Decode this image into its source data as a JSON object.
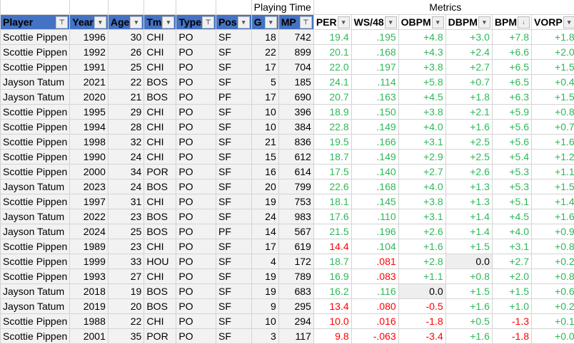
{
  "groups": {
    "playing_time": "Playing Time",
    "metrics": "Metrics"
  },
  "columns": [
    "Player",
    "Year",
    "Age",
    "Tm",
    "Type",
    "Pos",
    "G",
    "MP",
    "PER",
    "WS/48",
    "OBPM",
    "DBPM",
    "BPM",
    "VORP"
  ],
  "filter_icons": [
    "filter-active",
    "dropdown",
    "dropdown",
    "dropdown",
    "filter-active",
    "dropdown",
    "dropdown",
    "filter-active",
    "dropdown",
    "dropdown",
    "dropdown",
    "dropdown",
    "sort-desc",
    "dropdown"
  ],
  "colors": {
    "header": "#4472c4",
    "good": "#2fb85a",
    "bad": "#ff0000"
  },
  "rows": [
    [
      "Scottie Pippen",
      "1996",
      "30",
      "CHI",
      "PO",
      "SF",
      "18",
      "742",
      "19.4",
      ".195",
      "+4.8",
      "+3.0",
      "+7.8",
      "+1.8"
    ],
    [
      "Scottie Pippen",
      "1992",
      "26",
      "CHI",
      "PO",
      "SF",
      "22",
      "899",
      "20.1",
      ".168",
      "+4.3",
      "+2.4",
      "+6.6",
      "+2.0"
    ],
    [
      "Scottie Pippen",
      "1991",
      "25",
      "CHI",
      "PO",
      "SF",
      "17",
      "704",
      "22.0",
      ".197",
      "+3.8",
      "+2.7",
      "+6.5",
      "+1.5"
    ],
    [
      "Jayson Tatum",
      "2021",
      "22",
      "BOS",
      "PO",
      "SF",
      "5",
      "185",
      "24.1",
      ".114",
      "+5.8",
      "+0.7",
      "+6.5",
      "+0.4"
    ],
    [
      "Jayson Tatum",
      "2020",
      "21",
      "BOS",
      "PO",
      "PF",
      "17",
      "690",
      "20.7",
      ".163",
      "+4.5",
      "+1.8",
      "+6.3",
      "+1.5"
    ],
    [
      "Scottie Pippen",
      "1995",
      "29",
      "CHI",
      "PO",
      "SF",
      "10",
      "396",
      "18.9",
      ".150",
      "+3.8",
      "+2.1",
      "+5.9",
      "+0.8"
    ],
    [
      "Scottie Pippen",
      "1994",
      "28",
      "CHI",
      "PO",
      "SF",
      "10",
      "384",
      "22.8",
      ".149",
      "+4.0",
      "+1.6",
      "+5.6",
      "+0.7"
    ],
    [
      "Scottie Pippen",
      "1998",
      "32",
      "CHI",
      "PO",
      "SF",
      "21",
      "836",
      "19.5",
      ".166",
      "+3.1",
      "+2.5",
      "+5.6",
      "+1.6"
    ],
    [
      "Scottie Pippen",
      "1990",
      "24",
      "CHI",
      "PO",
      "SF",
      "15",
      "612",
      "18.7",
      ".149",
      "+2.9",
      "+2.5",
      "+5.4",
      "+1.2"
    ],
    [
      "Scottie Pippen",
      "2000",
      "34",
      "POR",
      "PO",
      "SF",
      "16",
      "614",
      "17.5",
      ".140",
      "+2.7",
      "+2.6",
      "+5.3",
      "+1.1"
    ],
    [
      "Jayson Tatum",
      "2023",
      "24",
      "BOS",
      "PO",
      "SF",
      "20",
      "799",
      "22.6",
      ".168",
      "+4.0",
      "+1.3",
      "+5.3",
      "+1.5"
    ],
    [
      "Scottie Pippen",
      "1997",
      "31",
      "CHI",
      "PO",
      "SF",
      "19",
      "753",
      "18.1",
      ".145",
      "+3.8",
      "+1.3",
      "+5.1",
      "+1.4"
    ],
    [
      "Jayson Tatum",
      "2022",
      "23",
      "BOS",
      "PO",
      "SF",
      "24",
      "983",
      "17.6",
      ".110",
      "+3.1",
      "+1.4",
      "+4.5",
      "+1.6"
    ],
    [
      "Jayson Tatum",
      "2024",
      "25",
      "BOS",
      "PO",
      "PF",
      "14",
      "567",
      "21.5",
      ".196",
      "+2.6",
      "+1.4",
      "+4.0",
      "+0.9"
    ],
    [
      "Scottie Pippen",
      "1989",
      "23",
      "CHI",
      "PO",
      "SF",
      "17",
      "619",
      "14.4",
      ".104",
      "+1.6",
      "+1.5",
      "+3.1",
      "+0.8"
    ],
    [
      "Scottie Pippen",
      "1999",
      "33",
      "HOU",
      "PO",
      "SF",
      "4",
      "172",
      "18.7",
      ".081",
      "+2.8",
      "0.0",
      "+2.7",
      "+0.2"
    ],
    [
      "Scottie Pippen",
      "1993",
      "27",
      "CHI",
      "PO",
      "SF",
      "19",
      "789",
      "16.9",
      ".083",
      "+1.1",
      "+0.8",
      "+2.0",
      "+0.8"
    ],
    [
      "Jayson Tatum",
      "2018",
      "19",
      "BOS",
      "PO",
      "SF",
      "19",
      "683",
      "16.2",
      ".116",
      "0.0",
      "+1.5",
      "+1.5",
      "+0.6"
    ],
    [
      "Jayson Tatum",
      "2019",
      "20",
      "BOS",
      "PO",
      "SF",
      "9",
      "295",
      "13.4",
      ".080",
      "-0.5",
      "+1.6",
      "+1.0",
      "+0.2"
    ],
    [
      "Scottie Pippen",
      "1988",
      "22",
      "CHI",
      "PO",
      "SF",
      "10",
      "294",
      "10.0",
      ".016",
      "-1.8",
      "+0.5",
      "-1.3",
      "+0.1"
    ],
    [
      "Scottie Pippen",
      "2001",
      "35",
      "POR",
      "PO",
      "SF",
      "3",
      "117",
      "9.8",
      "-.063",
      "-3.4",
      "+1.6",
      "-1.8",
      "+0.0"
    ]
  ]
}
